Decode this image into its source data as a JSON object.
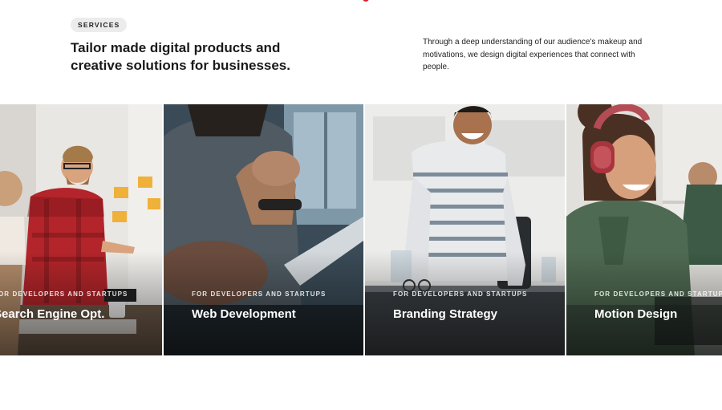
{
  "header": {
    "badge": "SERVICES",
    "headline": "Tailor made digital products and creative solutions for businesses.",
    "intro": "Through a deep understanding of our audience's makeup and motivations, we design digital experiences that connect with people."
  },
  "colors": {
    "accent": "#d8232a",
    "badge_bg": "#ececec"
  },
  "services": [
    {
      "eyebrow": "FOR DEVELOPERS AND STARTUPS",
      "title": "Search Engine Opt."
    },
    {
      "eyebrow": "FOR DEVELOPERS AND STARTUPS",
      "title": "Web Development"
    },
    {
      "eyebrow": "FOR DEVELOPERS AND STARTUPS",
      "title": "Branding Strategy"
    },
    {
      "eyebrow": "FOR DEVELOPERS AND STARTUPS",
      "title": "Motion Design"
    }
  ]
}
